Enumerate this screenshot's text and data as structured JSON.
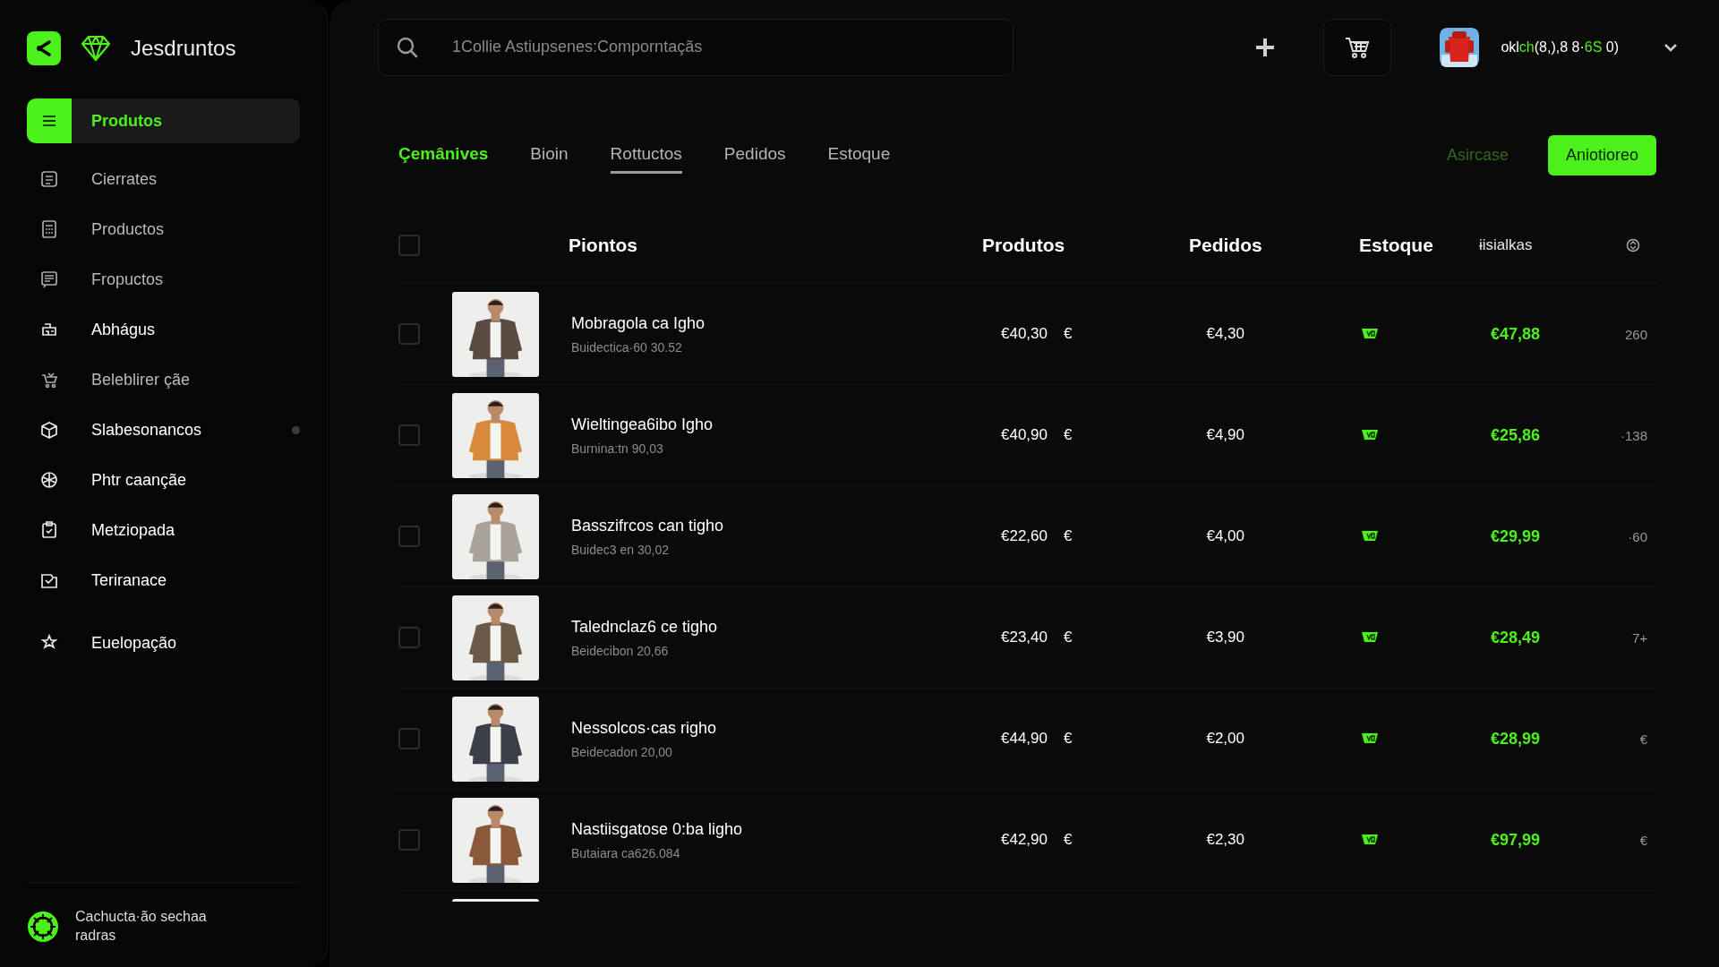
{
  "sidebar": {
    "brand": "Jesdruntos",
    "items": [
      {
        "label": "Produtos",
        "selected": true,
        "muted": false,
        "dot": false
      },
      {
        "label": "Cierrates",
        "selected": false,
        "muted": true,
        "dot": false
      },
      {
        "label": "Productos",
        "selected": false,
        "muted": true,
        "dot": false
      },
      {
        "label": "Fropuctos",
        "selected": false,
        "muted": true,
        "dot": false
      },
      {
        "label": "Abhágus",
        "selected": false,
        "muted": false,
        "dot": false
      },
      {
        "label": "Beleblirer çãe",
        "selected": false,
        "muted": true,
        "dot": false
      },
      {
        "label": "Slabesonancos",
        "selected": false,
        "muted": false,
        "dot": true
      },
      {
        "label": "Phtr caançãe",
        "selected": false,
        "muted": false,
        "dot": false
      },
      {
        "label": "Metziopada",
        "selected": false,
        "muted": false,
        "dot": false
      },
      {
        "label": "Teriranace",
        "selected": false,
        "muted": false,
        "dot": false
      },
      {
        "label": "Euelopação",
        "selected": false,
        "muted": false,
        "dot": false
      }
    ],
    "footer": "Cachucta·ão sechaa radras"
  },
  "topbar": {
    "search": {
      "value": "1Collie Astiupsenes:Comporntaçãs"
    },
    "user_label": [
      {
        "text": "okl",
        "accent": false
      },
      {
        "text": "ch",
        "accent": true
      },
      {
        "text": "(8,),8 8·",
        "accent": false
      },
      {
        "text": "6S",
        "accent": true
      },
      {
        "text": " 0)",
        "accent": false
      }
    ]
  },
  "tabs": [
    {
      "label": "Çemânives",
      "selected": true,
      "underlined": false
    },
    {
      "label": "Bioin",
      "selected": false,
      "underlined": false
    },
    {
      "label": "Rottuctos",
      "selected": false,
      "underlined": true
    },
    {
      "label": "Pedidos",
      "selected": false,
      "underlined": false
    },
    {
      "label": "Estoque",
      "selected": false,
      "underlined": false
    }
  ],
  "actions": {
    "link": "Asircase",
    "button": "Aniotioreo"
  },
  "table": {
    "header_checked": false,
    "columns": [
      "Piontos",
      "Produtos",
      "Pedidos",
      "Estoque",
      "ɨisialkas"
    ],
    "rows": [
      {
        "kind": "product",
        "checked": false,
        "name": "Mobragola ca Igho",
        "detail": "Buidectica·60 30.52",
        "price": "€40,30",
        "currency": "€",
        "orders": "€4,30",
        "total": "€47,88",
        "extra": "260"
      },
      {
        "kind": "product",
        "checked": false,
        "name": "Wieltingea6ibo Igho",
        "detail": "Burnina:tn 90,03",
        "price": "€40,90",
        "currency": "€",
        "orders": "€4,90",
        "total": "€25,86",
        "extra": "·138"
      },
      {
        "kind": "product",
        "checked": false,
        "name": "Basszifrcos can tigho",
        "detail": "Buidec3 en 30,02",
        "price": "€22,60",
        "currency": "€",
        "orders": "€4,00",
        "total": "€29,99",
        "extra": "·60"
      },
      {
        "kind": "product",
        "checked": false,
        "name": "Talednclaz6 ce tigho",
        "detail": "Beidecibon 20,66",
        "price": "€23,40",
        "currency": "€",
        "orders": "€3,90",
        "total": "€28,49",
        "extra": "7+"
      },
      {
        "kind": "product",
        "checked": false,
        "name": "Nessolcos·cas righo",
        "detail": "Beidecadon 20,00",
        "price": "€44,90",
        "currency": "€",
        "orders": "€2,00",
        "total": "€28,99",
        "extra": "€"
      },
      {
        "kind": "product",
        "checked": false,
        "name": "Nastiisgatose 0:ba ligho",
        "detail": "Butaiara ca626.084",
        "price": "€42,90",
        "currency": "€",
        "orders": "€2,30",
        "total": "€97,99",
        "extra": "€"
      },
      {
        "kind": "picture"
      }
    ]
  }
}
